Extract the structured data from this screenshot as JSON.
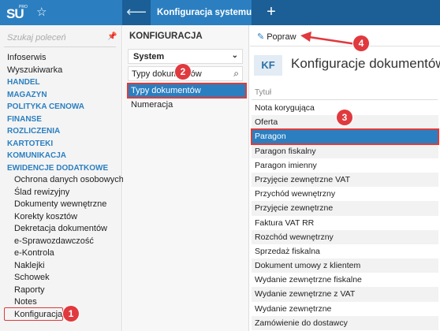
{
  "app": {
    "logo_text": "SU",
    "logo_sup": "PRO",
    "active_tab": "Konfiguracja systemu"
  },
  "sidebar": {
    "search_placeholder": "Szukaj poleceń",
    "items": [
      {
        "label": "Infoserwis",
        "type": "item"
      },
      {
        "label": "Wyszukiwarka",
        "type": "item"
      },
      {
        "label": "HANDEL",
        "type": "section"
      },
      {
        "label": "MAGAZYN",
        "type": "section"
      },
      {
        "label": "POLITYKA CENOWA",
        "type": "section"
      },
      {
        "label": "FINANSE",
        "type": "section"
      },
      {
        "label": "ROZLICZENIA",
        "type": "section"
      },
      {
        "label": "KARTOTEKI",
        "type": "section"
      },
      {
        "label": "KOMUNIKACJA",
        "type": "section"
      },
      {
        "label": "EWIDENCJE DODATKOWE",
        "type": "section"
      },
      {
        "label": "Ochrona danych osobowych",
        "type": "sub"
      },
      {
        "label": "Ślad rewizyjny",
        "type": "sub"
      },
      {
        "label": "Dokumenty wewnętrzne",
        "type": "sub"
      },
      {
        "label": "Korekty kosztów",
        "type": "sub"
      },
      {
        "label": "Dekretacja dokumentów",
        "type": "sub"
      },
      {
        "label": "e-Sprawozdawczość",
        "type": "sub"
      },
      {
        "label": "e-Kontrola",
        "type": "sub"
      },
      {
        "label": "Naklejki",
        "type": "sub"
      },
      {
        "label": "Schowek",
        "type": "sub"
      },
      {
        "label": "Raporty",
        "type": "sub"
      },
      {
        "label": "Notes",
        "type": "sub"
      },
      {
        "label": "Konfiguracja",
        "type": "sub"
      }
    ]
  },
  "middle": {
    "title": "KONFIGURACJA",
    "select_value": "System",
    "search_value": "Typy dokumentów",
    "items": [
      {
        "label": "Typy dokumentów",
        "selected": true
      },
      {
        "label": "Numeracja",
        "selected": false
      }
    ]
  },
  "content": {
    "edit_label": "Popraw",
    "badge": "KF",
    "title": "Konfiguracje dokumentów",
    "column_header": "Tytuł",
    "rows": [
      "Nota korygująca",
      "Oferta",
      "Paragon",
      "Paragon fiskalny",
      "Paragon imienny",
      "Przyjęcie zewnętrzne VAT",
      "Przychód wewnętrzny",
      "Przyjęcie zewnętrzne",
      "Faktura VAT RR",
      "Rozchód wewnętrzny",
      "Sprzedaż fiskalna",
      "Dokument umowy z klientem",
      "Wydanie zewnętrzne fiskalne",
      "Wydanie zewnętrzne z VAT",
      "Wydanie zewnętrzne",
      "Zamówienie do dostawcy"
    ],
    "selected_row": "Paragon"
  },
  "annotations": {
    "step1": "1",
    "step2": "2",
    "step3": "3",
    "step4": "4",
    "color": "#e0393e"
  }
}
